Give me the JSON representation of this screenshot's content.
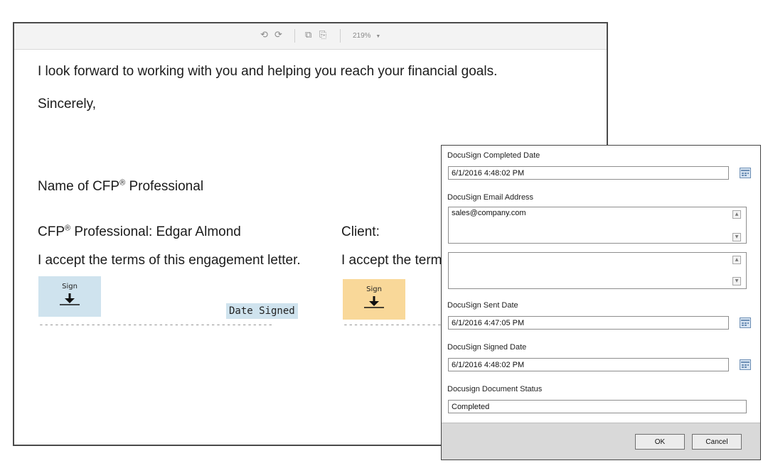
{
  "toolbar": {
    "undo_icon": "undo-icon",
    "redo_icon": "redo-icon",
    "copy_icon": "copy-icon",
    "paste_icon": "paste-icon",
    "zoom_label": "219%",
    "zoom_arrow": "▼"
  },
  "letter": {
    "line1": "I look forward to working with you and helping you reach your financial goals.",
    "line2": "Sincerely,",
    "name_label_pre": "Name of CFP",
    "name_label_reg": "®",
    "name_label_post": " Professional",
    "cfp_line_pre": "CFP",
    "cfp_line_reg": "®",
    "cfp_line_post": " Professional: Edgar Almond",
    "client_line": "Client:",
    "accept_cfp": "I accept the terms of this engagement letter.",
    "accept_client": "I accept the term",
    "sign_label": "Sign",
    "date_signed": "Date Signed",
    "sig_line_cfp": "---------------------------------------------",
    "sig_line_client": "-------------------",
    "colors": {
      "sign_cfp": "#cfe3ee",
      "sign_client": "#f9d899"
    }
  },
  "dialog": {
    "completed_date_label": "DocuSign Completed Date",
    "completed_date_value": "6/1/2016 4:48:02 PM",
    "email_label": "DocuSign Email Address",
    "email_value": "sales@company.com",
    "sent_date_label": "DocuSign Sent Date",
    "sent_date_value": "6/1/2016 4:47:05 PM",
    "signed_date_label": "DocuSign Signed Date",
    "signed_date_value": "6/1/2016 4:48:02 PM",
    "status_label": "Docusign Document Status",
    "status_value": "Completed",
    "ok_label": "OK",
    "cancel_label": "Cancel",
    "calendar_icon": "calendar-icon",
    "scroll_up_icon": "scroll-up-icon",
    "scroll_down_icon": "scroll-down-icon"
  }
}
